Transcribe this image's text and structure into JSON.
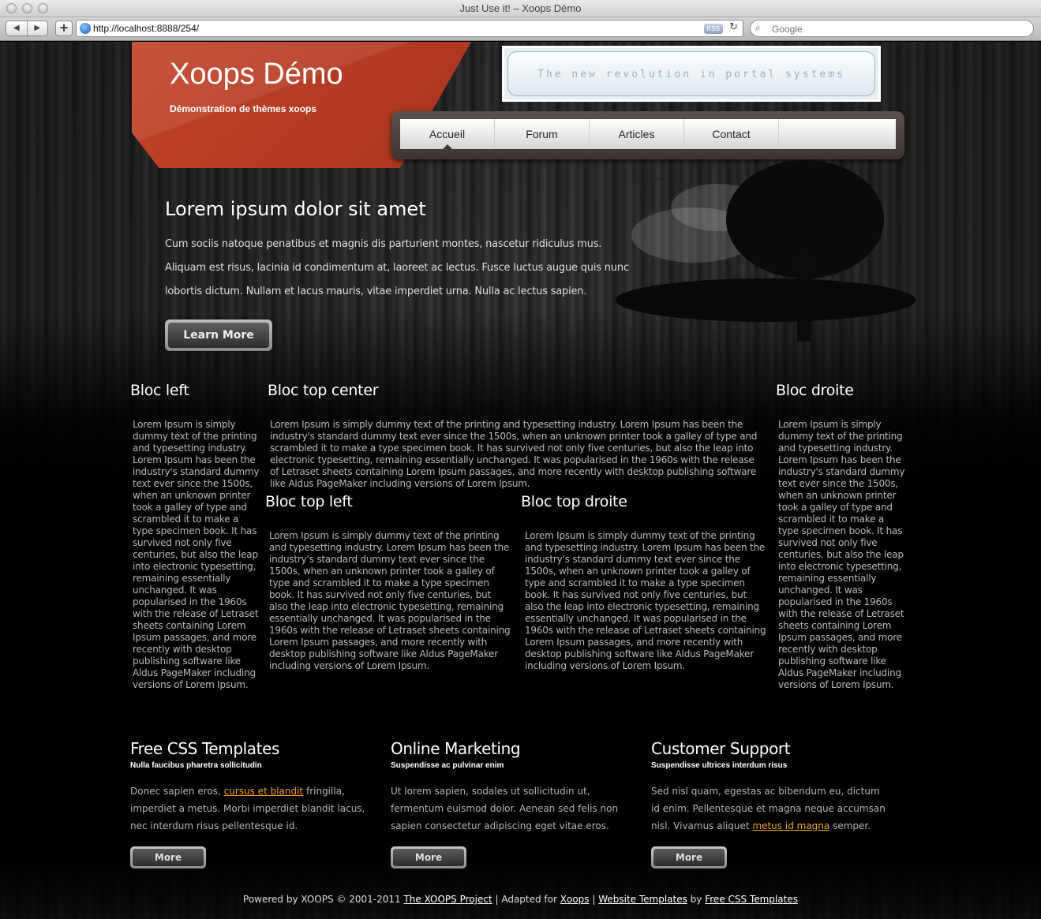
{
  "window": {
    "title": "Just Use it! – Xoops Démo"
  },
  "toolbar": {
    "back_label": "◀",
    "forward_label": "▶",
    "add_label": "+",
    "url": "http://localhost:8888/254/",
    "rss_label": "RSS",
    "search_placeholder": "Google"
  },
  "header": {
    "site_title": "Xoops Démo",
    "slogan": "Démonstration de thèmes xoops",
    "banner_text": "The new revolution in portal systems"
  },
  "menu": {
    "items": [
      {
        "label": "Accueil",
        "active": true
      },
      {
        "label": "Forum"
      },
      {
        "label": "Articles"
      },
      {
        "label": "Contact"
      }
    ]
  },
  "hero": {
    "title": "Lorem ipsum dolor sit amet",
    "text": "Cum sociis natoque penatibus et magnis dis parturient montes, nascetur ridiculus mus. Aliquam est risus, lacinia id condimentum at, laoreet ac lectus. Fusce luctus augue quis nunc lobortis dictum. Nullam et lacus mauris, vitae imperdiet urna. Nulla ac lectus sapien.",
    "button_label": "Learn More"
  },
  "blocks": {
    "left": {
      "title": "Bloc left",
      "text": "Lorem Ipsum is simply dummy text of the printing and typesetting industry. Lorem Ipsum has been the industry's standard dummy text ever since the 1500s, when an unknown printer took a galley of type and scrambled it to make a type specimen book. It has survived not only five centuries, but also the leap into electronic typesetting, remaining essentially unchanged. It was popularised in the 1960s with the release of Letraset sheets containing Lorem Ipsum passages, and more recently with desktop publishing software like Aldus PageMaker including versions of Lorem Ipsum."
    },
    "top_center": {
      "title": "Bloc top center",
      "text": "Lorem Ipsum is simply dummy text of the printing and typesetting industry. Lorem Ipsum has been the industry's standard dummy text ever since the 1500s, when an unknown printer took a galley of type and scrambled it to make a type specimen book. It has survived not only five centuries, but also the leap into electronic typesetting, remaining essentially unchanged. It was popularised in the 1960s with the release of Letraset sheets containing Lorem Ipsum passages, and more recently with desktop publishing software like Aldus PageMaker including versions of Lorem Ipsum."
    },
    "top_left": {
      "title": "Bloc top left",
      "text": "Lorem Ipsum is simply dummy text of the printing and typesetting industry. Lorem Ipsum has been the industry's standard dummy text ever since the 1500s, when an unknown printer took a galley of type and scrambled it to make a type specimen book. It has survived not only five centuries, but also the leap into electronic typesetting, remaining essentially unchanged. It was popularised in the 1960s with the release of Letraset sheets containing Lorem Ipsum passages, and more recently with desktop publishing software like Aldus PageMaker including versions of Lorem Ipsum."
    },
    "top_right": {
      "title": "Bloc top droite",
      "text": "Lorem Ipsum is simply dummy text of the printing and typesetting industry. Lorem Ipsum has been the industry's standard dummy text ever since the 1500s, when an unknown printer took a galley of type and scrambled it to make a type specimen book. It has survived not only five centuries, but also the leap into electronic typesetting, remaining essentially unchanged. It was popularised in the 1960s with the release of Letraset sheets containing Lorem Ipsum passages, and more recently with desktop publishing software like Aldus PageMaker including versions of Lorem Ipsum."
    },
    "right": {
      "title": "Bloc droite",
      "text": "Lorem Ipsum is simply dummy text of the printing and typesetting industry. Lorem Ipsum has been the industry's standard dummy text ever since the 1500s, when an unknown printer took a galley of type and scrambled it to make a type specimen book. It has survived not only five centuries, but also the leap into electronic typesetting, remaining essentially unchanged. It was popularised in the 1960s with the release of Letraset sheets containing Lorem Ipsum passages, and more recently with desktop publishing software like Aldus PageMaker including versions of Lorem Ipsum."
    }
  },
  "columns": [
    {
      "title": "Free CSS Templates",
      "subtitle": "Nulla faucibus pharetra sollicitudin",
      "text_before": "Donec sapien eros, ",
      "link": "cursus et blandit",
      "text_after": " fringilla, imperdiet a metus. Morbi imperdiet blandit lacus, nec interdum risus pellentesque id.",
      "button": "More"
    },
    {
      "title": "Online Marketing",
      "subtitle": "Suspendisse ac pulvinar enim",
      "text_before": "Ut lorem sapien, sodales ut sollicitudin ut, fermentum euismod dolor. Aenean sed felis non sapien consectetur adipiscing eget vitae eros.",
      "link": "",
      "text_after": "",
      "button": "More"
    },
    {
      "title": "Customer Support",
      "subtitle": "Suspendisse ultrices interdum risus",
      "text_before": "Sed nisl quam, egestas ac bibendum eu, dictum id enim. Pellentesque et magna neque accumsan nisl. Vivamus aliquet ",
      "link": "metus id magna",
      "text_after": " semper.",
      "button": "More"
    }
  ],
  "footer": {
    "powered": "Powered by XOOPS © 2001-2011 ",
    "xoops_project": "The XOOPS Project",
    "adapted": " | Adapted for ",
    "xoops": "Xoops",
    "sep": " | ",
    "website_templates": "Website Templates",
    "by": " by ",
    "free_css": "Free CSS Templates"
  },
  "colors": {
    "brand": "#b23a22",
    "link": "#f0a020",
    "menu_frame": "#4a4240"
  }
}
